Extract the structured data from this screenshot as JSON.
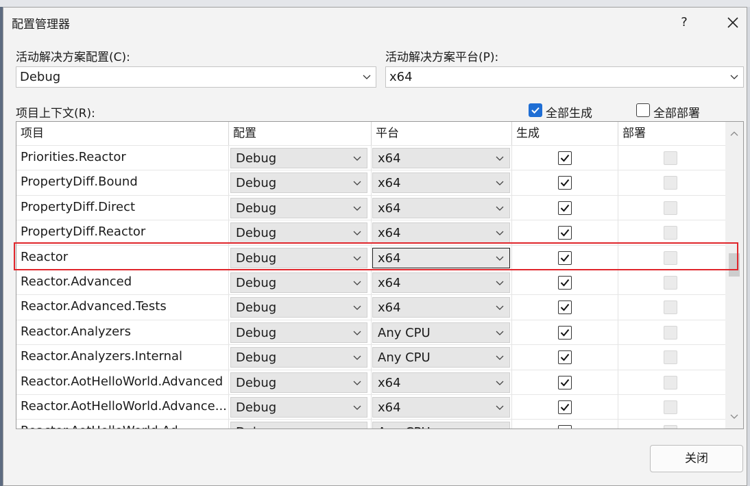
{
  "dialog": {
    "title": "配置管理器",
    "help_label": "?"
  },
  "active_config": {
    "label": "活动解决方案配置(C):",
    "value": "Debug"
  },
  "active_platform": {
    "label": "活动解决方案平台(P):",
    "value": "x64"
  },
  "project_context": {
    "label": "项目上下文(R):",
    "build_all": {
      "label": "全部生成",
      "checked": true
    },
    "deploy_all": {
      "label": "全部部署",
      "checked": false
    }
  },
  "grid": {
    "columns": [
      "项目",
      "配置",
      "平台",
      "生成",
      "部署"
    ],
    "rows": [
      {
        "project": "Priorities.Reactor",
        "config": "Debug",
        "platform": "x64",
        "build": true,
        "deploy": false
      },
      {
        "project": "PropertyDiff.Bound",
        "config": "Debug",
        "platform": "x64",
        "build": true,
        "deploy": false
      },
      {
        "project": "PropertyDiff.Direct",
        "config": "Debug",
        "platform": "x64",
        "build": true,
        "deploy": false
      },
      {
        "project": "PropertyDiff.Reactor",
        "config": "Debug",
        "platform": "x64",
        "build": true,
        "deploy": false
      },
      {
        "project": "Reactor",
        "config": "Debug",
        "platform": "x64",
        "build": true,
        "deploy": false,
        "highlighted": true
      },
      {
        "project": "Reactor.Advanced",
        "config": "Debug",
        "platform": "x64",
        "build": true,
        "deploy": false
      },
      {
        "project": "Reactor.Advanced.Tests",
        "config": "Debug",
        "platform": "x64",
        "build": true,
        "deploy": false
      },
      {
        "project": "Reactor.Analyzers",
        "config": "Debug",
        "platform": "Any CPU",
        "build": true,
        "deploy": false
      },
      {
        "project": "Reactor.Analyzers.Internal",
        "config": "Debug",
        "platform": "Any CPU",
        "build": true,
        "deploy": false
      },
      {
        "project": "Reactor.AotHelloWorld.Advanced",
        "config": "Debug",
        "platform": "x64",
        "build": true,
        "deploy": false
      },
      {
        "project": "Reactor.AotHelloWorld.Advance...",
        "config": "Debug",
        "platform": "x64",
        "build": true,
        "deploy": false
      },
      {
        "project": "Reactor.AotHelloWorld.Ad",
        "config": "Debug",
        "platform": "Any CPU",
        "build": true,
        "deploy": false
      }
    ]
  },
  "footer": {
    "close_label": "关闭"
  },
  "colors": {
    "accent": "#1f6ed4",
    "highlight_border": "#e0252b"
  }
}
